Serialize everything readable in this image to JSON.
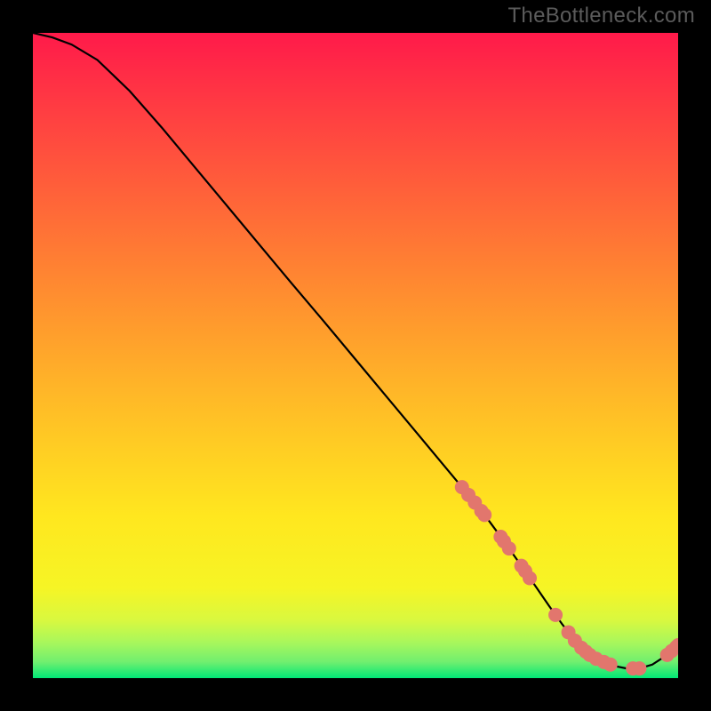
{
  "watermark": "TheBottleneck.com",
  "chart_data": {
    "type": "line",
    "title": "",
    "xlabel": "",
    "ylabel": "",
    "xlim": [
      0,
      100
    ],
    "ylim": [
      0,
      100
    ],
    "background": {
      "top_color": "#ff1a4a",
      "bottom_color": "#00e776",
      "bands": [
        "#ff1a4a",
        "#ff3d42",
        "#ff5f3a",
        "#ff7e33",
        "#ff9a2d",
        "#ffb528",
        "#ffcf23",
        "#ffe71f",
        "#f6f525",
        "#d9f83f",
        "#a8f75c",
        "#70ef6f",
        "#00e776"
      ]
    },
    "curve": {
      "description": "Bottleneck curve: high at left, falling roughly linearly to a minimum near x≈86, then rising slightly toward the right edge.",
      "x": [
        0,
        3,
        6,
        10,
        15,
        20,
        25,
        30,
        35,
        40,
        45,
        50,
        55,
        60,
        65,
        68,
        70,
        72,
        74,
        76,
        78,
        80,
        82,
        84,
        86,
        88,
        90,
        92,
        94,
        96,
        98,
        100
      ],
      "y": [
        100,
        99.3,
        98.2,
        95.8,
        91.0,
        85.3,
        79.3,
        73.3,
        67.3,
        61.3,
        55.4,
        49.4,
        43.4,
        37.4,
        31.4,
        27.8,
        25.3,
        22.6,
        19.8,
        17.0,
        14.1,
        11.2,
        8.4,
        5.8,
        3.8,
        2.6,
        1.9,
        1.5,
        1.5,
        2.1,
        3.4,
        5.1
      ]
    },
    "markers": {
      "description": "Highlighted sample points along the curve (coral dots).",
      "color": "#e2766d",
      "radius_px": 8,
      "points": [
        {
          "x": 66.5,
          "y": 29.6
        },
        {
          "x": 67.5,
          "y": 28.4
        },
        {
          "x": 68.5,
          "y": 27.2
        },
        {
          "x": 69.5,
          "y": 25.9
        },
        {
          "x": 70.0,
          "y": 25.3
        },
        {
          "x": 72.5,
          "y": 21.9
        },
        {
          "x": 73.0,
          "y": 21.2
        },
        {
          "x": 73.8,
          "y": 20.1
        },
        {
          "x": 75.7,
          "y": 17.4
        },
        {
          "x": 76.3,
          "y": 16.6
        },
        {
          "x": 77.0,
          "y": 15.5
        },
        {
          "x": 81.0,
          "y": 9.8
        },
        {
          "x": 83.0,
          "y": 7.1
        },
        {
          "x": 84.0,
          "y": 5.8
        },
        {
          "x": 85.0,
          "y": 4.7
        },
        {
          "x": 85.7,
          "y": 4.1
        },
        {
          "x": 86.3,
          "y": 3.6
        },
        {
          "x": 87.3,
          "y": 3.0
        },
        {
          "x": 88.5,
          "y": 2.5
        },
        {
          "x": 89.5,
          "y": 2.1
        },
        {
          "x": 93.0,
          "y": 1.5
        },
        {
          "x": 94.0,
          "y": 1.5
        },
        {
          "x": 98.3,
          "y": 3.6
        },
        {
          "x": 99.0,
          "y": 4.2
        },
        {
          "x": 99.7,
          "y": 4.8
        },
        {
          "x": 100.0,
          "y": 5.1
        }
      ]
    }
  }
}
